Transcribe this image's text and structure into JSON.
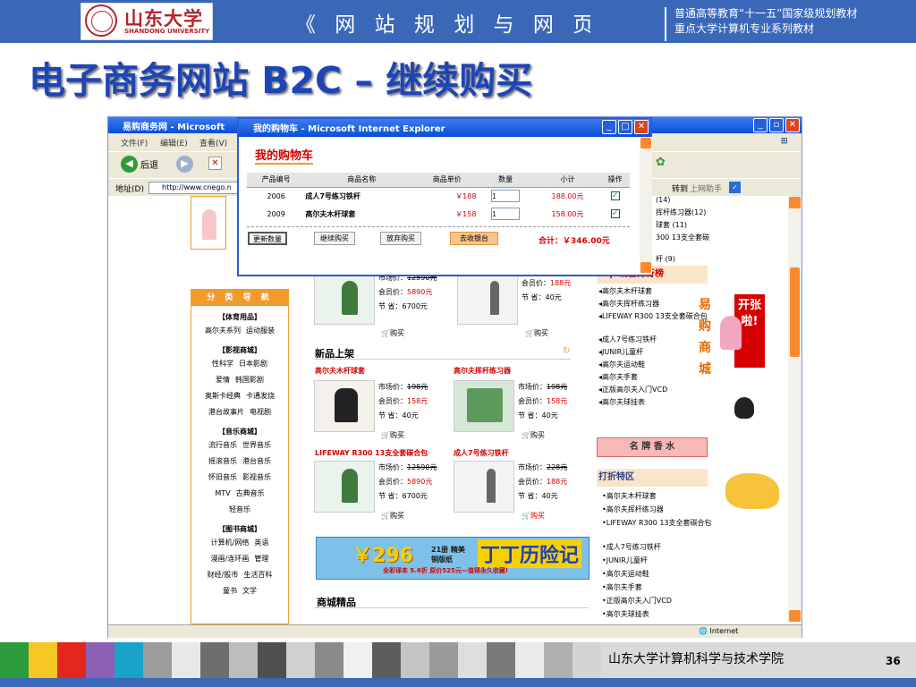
{
  "header": {
    "univ_cn": "山东大学",
    "univ_en": "SHANDONG UNIVERSITY",
    "course_title": "《 网 站 规 划 与 网 页 设 计 》",
    "series_line1": "普通高等教育“十一五”国家级规划教材",
    "series_line2": "重点大学计算机专业系列教材"
  },
  "slide": {
    "title": "电子商务网站 B2C – 继续购买"
  },
  "footer": {
    "institute": "山东大学计算机科学与技术学院",
    "page": "36"
  },
  "colors": {
    "topbar": "#3a67b8",
    "title": "#1d45b5",
    "accent": "#f39b2a",
    "price": "#d60000"
  },
  "browser": {
    "title": "易购商务网 - Microsoft",
    "menu": [
      "文件(F)",
      "编辑(E)",
      "查看(V)"
    ],
    "back": "后退",
    "address_label": "地址(D)",
    "address": "http://www.cnego.n",
    "go": "转到",
    "links": "上网助手",
    "status": "Internet"
  },
  "cart": {
    "window_title": "我的购物车 - Microsoft Internet Explorer",
    "heading": "我的购物车",
    "columns": [
      "产品编号",
      "商品名称",
      "商品单价",
      "数量",
      "小计",
      "操作"
    ],
    "rows": [
      {
        "id": "2006",
        "name": "成人7号练习铁杆",
        "price": "￥188",
        "qty": "1",
        "subtotal": "188.00元"
      },
      {
        "id": "2009",
        "name": "高尔夫木杆球套",
        "price": "￥158",
        "qty": "1",
        "subtotal": "158.00元"
      }
    ],
    "buttons": [
      "更新数量",
      "继续购买",
      "放弃购买",
      "去收银台"
    ],
    "total": "合计：￥346.00元"
  },
  "nav": {
    "head": "分 类 导 航",
    "sections": [
      {
        "title": "【体育用品】",
        "rows": [
          [
            "高尔夫系列",
            "运动服装"
          ]
        ]
      },
      {
        "title": "【影视商城】",
        "rows": [
          [
            "性科学",
            "日本影剧"
          ],
          [
            "爱情",
            "韩国影剧"
          ],
          [
            "奥斯卡经典",
            "卡通发烧"
          ],
          [
            "港台故事片",
            "电视剧"
          ]
        ]
      },
      {
        "title": "【音乐商城】",
        "rows": [
          [
            "流行音乐",
            "世界音乐"
          ],
          [
            "摇滚音乐",
            "港台音乐"
          ],
          [
            "怀旧音乐",
            "影视音乐"
          ],
          [
            "MTV",
            "古典音乐"
          ],
          [
            "轻音乐"
          ]
        ]
      },
      {
        "title": "【图书商城】",
        "rows": [
          [
            "计算机/网络",
            "英语"
          ],
          [
            "漫画/连环画",
            "管理"
          ],
          [
            "财经/股市",
            "生活百科"
          ],
          [
            "童书",
            "文学"
          ]
        ]
      }
    ]
  },
  "products": {
    "top_left": {
      "market": "市场价：",
      "market_val": "12590元",
      "member": "会员价：",
      "member_val": "5890元",
      "save": "节  省：",
      "save_val": "6700元",
      "buy": "购买"
    },
    "top_right": {
      "member": "会员价：",
      "member_val": "188元",
      "save": "节  省：",
      "save_val": "40元",
      "buy": "购买"
    },
    "new_title": "新品上架",
    "new_left": {
      "name": "高尔夫木杆球套",
      "market": "市场价：",
      "market_val": "198元",
      "member": "会员价：",
      "member_val": "158元",
      "save": "节  省：",
      "save_val": "40元",
      "buy": "购买"
    },
    "new_right": {
      "name": "高尔夫挥杆练习器",
      "market": "市场价：",
      "market_val": "198元",
      "member": "会员价：",
      "member_val": "158元",
      "save": "节  省：",
      "save_val": "40元",
      "buy": "购买"
    },
    "mid_left": {
      "name": "LIFEWAY R300 13支全套碳合包",
      "market": "市场价：",
      "market_val": "12590元",
      "member": "会员价：",
      "member_val": "5890元",
      "save": "节  省：",
      "save_val": "6700元",
      "buy": "购买"
    },
    "mid_right": {
      "name": "成人7号练习铁杆",
      "market": "市场价：",
      "market_val": "228元",
      "member": "会员价：",
      "member_val": "188元",
      "save": "节  省：",
      "save_val": "40元",
      "buy": "购买"
    },
    "banner_price": "￥296",
    "banner_sub": "21册 精美铜版纸",
    "banner_title": "丁丁历险记",
    "banner_note": "全彩译本 5.6折 原价525元—值得永久收藏!",
    "mall_title": "商城精品"
  },
  "sidebar": {
    "partial_top": [
      "(14)",
      "挥杆练习器(12)",
      "球套 (11)",
      "300 13支全套碳",
      "杆 (9)"
    ],
    "rank_head": "Top 销售排行榜",
    "rank_items": [
      "高尔夫木杆球套",
      "高尔夫挥杆练习器",
      "LIFEWAY R300 13支全套碳合包",
      "成人7号练习铁杆",
      "JUNIR儿童杆",
      "高尔夫运动鞋",
      "高尔夫手套",
      "正版高尔夫入门VCD",
      "高尔夫球挂表"
    ],
    "banner_vertical": "易购商城",
    "sign": "开张啦!",
    "perfume": "名 牌 香 水",
    "discount_head": "打折特区",
    "discount_items": [
      "高尔夫木杆球套",
      "高尔夫挥杆练习器",
      "LIFEWAY R300 13支全套碳合包",
      "成人7号练习铁杆",
      "JUNIR儿童杆",
      "高尔夫运动鞋",
      "高尔夫手套",
      "正版高尔夫入门VCD",
      "高尔夫球挂表"
    ]
  }
}
